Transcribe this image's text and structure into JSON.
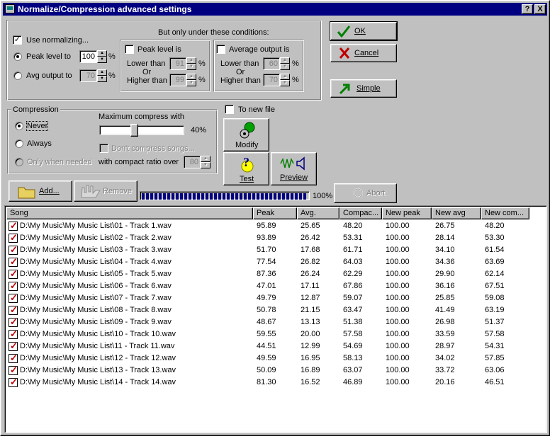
{
  "window": {
    "title": "Normalize/Compression advanced settings",
    "help_label": "?",
    "close_label": "X"
  },
  "normalize": {
    "use_label": "Use normalizing...",
    "use_checked": true,
    "peak_label": "Peak level to",
    "peak_value": "100",
    "avg_label": "Avg output to",
    "avg_value": "70",
    "percent": "%",
    "conditions_label": "But only under these conditions:",
    "peak_cond": {
      "label": "Peak level is",
      "lower_label": "Lower than",
      "or_label": "Or",
      "higher_label": "Higher than",
      "lower_value": "91",
      "higher_value": "99"
    },
    "avg_cond": {
      "label": "Average output is",
      "lower_label": "Lower than",
      "or_label": "Or",
      "higher_label": "Higher than",
      "lower_value": "60",
      "higher_value": "70"
    }
  },
  "buttons": {
    "ok": "OK",
    "cancel": "Cancel",
    "simple": "Simple",
    "modify": "Modify",
    "test": "Test",
    "preview": "Preview",
    "add": "Add...",
    "remove": "Remove",
    "abort": "Abort"
  },
  "to_new_file": {
    "label": "To new file",
    "checked": false
  },
  "compression": {
    "group_label": "Compression",
    "never": "Never",
    "always": "Always",
    "only_when_needed": "Only when needed",
    "selected": "never",
    "max_compress_label": "Maximum compress with",
    "max_compress_value": "40%",
    "max_compress_fraction": 0.4,
    "dont_compress_label": "Don't compress songs...",
    "ratio_label": "with compact ratio over",
    "ratio_value": "80"
  },
  "progress": {
    "label": "100%",
    "fraction": 1.0
  },
  "table": {
    "columns": [
      "Song",
      "Peak",
      "Avg.",
      "Compac...",
      "New peak",
      "New avg",
      "New com..."
    ],
    "rows": [
      [
        "D:\\My Music\\My Music List\\01 - Track  1.wav",
        "95.89",
        "25.65",
        "48.20",
        "100.00",
        "26.75",
        "48.20"
      ],
      [
        "D:\\My Music\\My Music List\\02 - Track  2.wav",
        "93.89",
        "26.42",
        "53.31",
        "100.00",
        "28.14",
        "53.30"
      ],
      [
        "D:\\My Music\\My Music List\\03 - Track  3.wav",
        "51.70",
        "17.68",
        "61.71",
        "100.00",
        "34.10",
        "61.54"
      ],
      [
        "D:\\My Music\\My Music List\\04 - Track  4.wav",
        "77.54",
        "26.82",
        "64.03",
        "100.00",
        "34.36",
        "63.69"
      ],
      [
        "D:\\My Music\\My Music List\\05 - Track  5.wav",
        "87.36",
        "26.24",
        "62.29",
        "100.00",
        "29.90",
        "62.14"
      ],
      [
        "D:\\My Music\\My Music List\\06 - Track  6.wav",
        "47.01",
        "17.11",
        "67.86",
        "100.00",
        "36.16",
        "67.51"
      ],
      [
        "D:\\My Music\\My Music List\\07 - Track  7.wav",
        "49.79",
        "12.87",
        "59.07",
        "100.00",
        "25.85",
        "59.08"
      ],
      [
        "D:\\My Music\\My Music List\\08 - Track  8.wav",
        "50.78",
        "21.15",
        "63.47",
        "100.00",
        "41.49",
        "63.19"
      ],
      [
        "D:\\My Music\\My Music List\\09 - Track  9.wav",
        "48.67",
        "13.13",
        "51.38",
        "100.00",
        "26.98",
        "51.37"
      ],
      [
        "D:\\My Music\\My Music List\\10 - Track 10.wav",
        "59.55",
        "20.00",
        "57.58",
        "100.00",
        "33.59",
        "57.58"
      ],
      [
        "D:\\My Music\\My Music List\\11 - Track 11.wav",
        "44.51",
        "12.99",
        "54.69",
        "100.00",
        "28.97",
        "54.31"
      ],
      [
        "D:\\My Music\\My Music List\\12 - Track 12.wav",
        "49.59",
        "16.95",
        "58.13",
        "100.00",
        "34.02",
        "57.85"
      ],
      [
        "D:\\My Music\\My Music List\\13 - Track 13.wav",
        "50.09",
        "16.89",
        "63.07",
        "100.00",
        "33.72",
        "63.06"
      ],
      [
        "D:\\My Music\\My Music List\\14 - Track 14.wav",
        "81.30",
        "16.52",
        "46.89",
        "100.00",
        "20.16",
        "46.51"
      ]
    ]
  },
  "colors": {
    "titlebar": "#000080",
    "face": "#c0c0c0",
    "ok_check": "#008000",
    "cancel_x": "#c00000",
    "simple_arrow": "#008000"
  }
}
